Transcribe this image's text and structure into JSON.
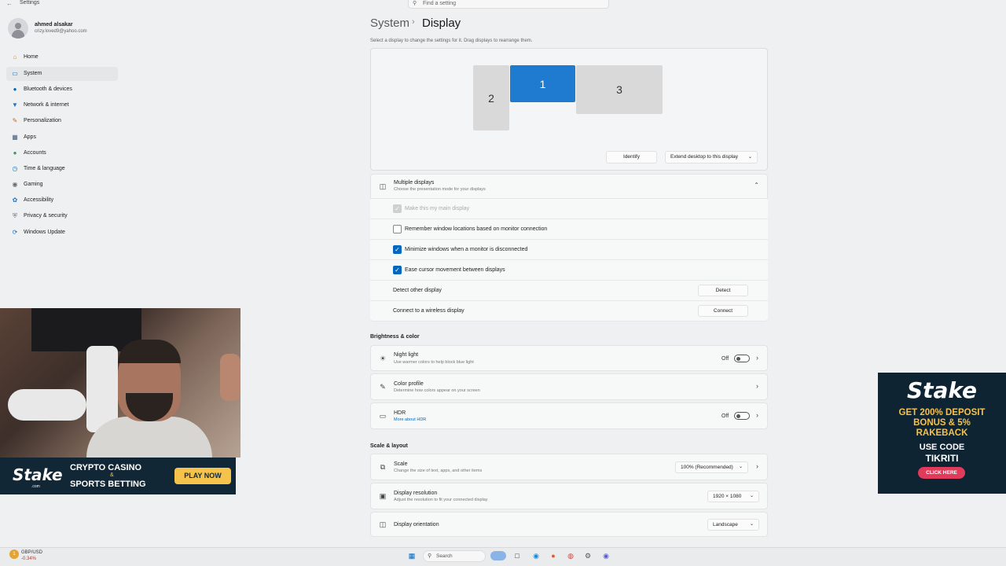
{
  "window": {
    "title": "Settings",
    "back_glyph": "←"
  },
  "search": {
    "placeholder": "Find a setting"
  },
  "user": {
    "name": "ahmed alsakar",
    "email": "crizy.loved9@yahoo.com"
  },
  "sidebar": {
    "items": [
      {
        "label": "Home",
        "icon": "home-icon"
      },
      {
        "label": "System",
        "icon": "system-icon",
        "selected": true
      },
      {
        "label": "Bluetooth & devices",
        "icon": "bluetooth-icon"
      },
      {
        "label": "Network & internet",
        "icon": "wifi-icon"
      },
      {
        "label": "Personalization",
        "icon": "brush-icon"
      },
      {
        "label": "Apps",
        "icon": "apps-icon"
      },
      {
        "label": "Accounts",
        "icon": "accounts-icon"
      },
      {
        "label": "Time & language",
        "icon": "globe-clock-icon"
      },
      {
        "label": "Gaming",
        "icon": "gamepad-icon"
      },
      {
        "label": "Accessibility",
        "icon": "accessibility-icon"
      },
      {
        "label": "Privacy & security",
        "icon": "shield-icon"
      },
      {
        "label": "Windows Update",
        "icon": "update-icon"
      }
    ]
  },
  "header": {
    "crumb1": "System",
    "sep": "›",
    "crumb2": "Display",
    "hint": "Select a display to change the settings for it. Drag displays to rearrange them."
  },
  "monitors": [
    "2",
    "1",
    "3"
  ],
  "display_panel": {
    "identify": "Identify",
    "extend": "Extend desktop to this display"
  },
  "multiple": {
    "title": "Multiple displays",
    "subtitle": "Choose the presentation mode for your displays",
    "make_main": "Make this my main display",
    "remember": "Remember window locations based on monitor connection",
    "minimize": "Minimize windows when a monitor is disconnected",
    "ease": "Ease cursor movement between displays",
    "detect_label": "Detect other display",
    "detect_btn": "Detect",
    "connect_label": "Connect to a wireless display",
    "connect_btn": "Connect"
  },
  "brightness": {
    "section": "Brightness & color",
    "night_title": "Night light",
    "night_sub": "Use warmer colors to help block blue light",
    "night_state": "Off",
    "profile_title": "Color profile",
    "profile_sub": "Determine how colors appear on your screen",
    "hdr_title": "HDR",
    "hdr_link": "More about HDR",
    "hdr_state": "Off"
  },
  "scale": {
    "section": "Scale & layout",
    "scale_title": "Scale",
    "scale_sub": "Change the size of text, apps, and other items",
    "scale_value": "100% (Recommended)",
    "res_title": "Display resolution",
    "res_sub": "Adjust the resolution to fit your connected display",
    "res_value": "1920 × 1080",
    "orient_title": "Display orientation",
    "orient_value": "Landscape"
  },
  "ad1": {
    "logo": "Stake",
    "logo_sub": ".com",
    "line1": "CRYPTO CASINO",
    "amp": "&",
    "line2": "SPORTS BETTING",
    "button": "PLAY NOW"
  },
  "ad2": {
    "logo": "Stake",
    "line1": "GET 200% DEPOSIT",
    "line2": "BONUS & 5%",
    "line3": "RAKEBACK",
    "line4": "USE CODE",
    "line5": "TIKRITI",
    "button": "CLICK HERE"
  },
  "taskbar": {
    "widget_badge": "1",
    "widget_title": "GBP/USD",
    "widget_value": "-0.34%",
    "search": "Search"
  },
  "colors": {
    "accent": "#0067c0",
    "selected_monitor": "#1e7bd0",
    "ad_bg": "#112735",
    "ad_yellow": "#f5c24b"
  }
}
